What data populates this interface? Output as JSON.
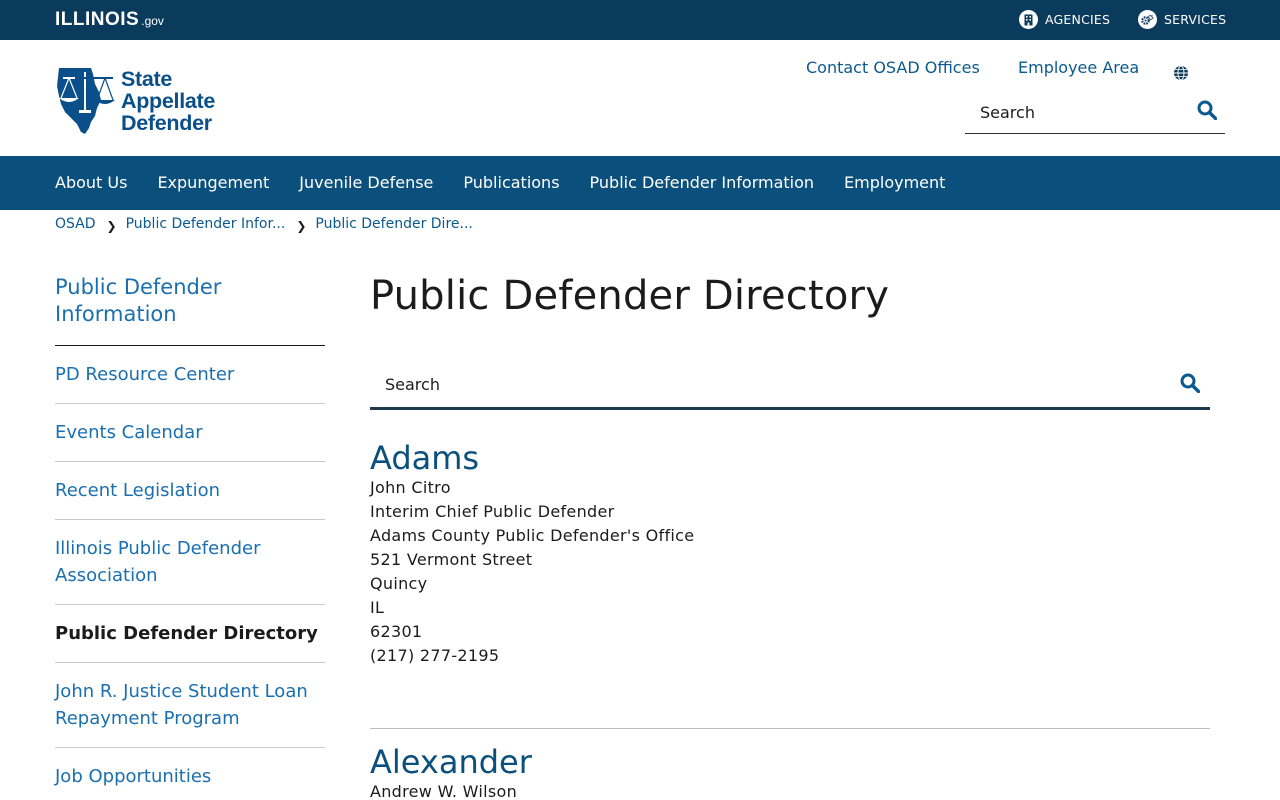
{
  "topbar": {
    "brand_main": "ILLINOIS",
    "brand_suffix": ".gov",
    "agencies_label": "AGENCIES",
    "services_label": "SERVICES"
  },
  "header": {
    "logo_lines": [
      "State",
      "Appellate",
      "Defender"
    ],
    "contact_link": "Contact OSAD Offices",
    "employee_link": "Employee Area",
    "search_placeholder": "Search"
  },
  "nav": {
    "items": [
      "About Us",
      "Expungement",
      "Juvenile Defense",
      "Publications",
      "Public Defender Information",
      "Employment"
    ]
  },
  "breadcrumb": [
    "OSAD",
    "Public Defender Infor...",
    "Public Defender Dire..."
  ],
  "sidebar": {
    "title": "Public Defender Information",
    "items": [
      {
        "label": "PD Resource Center",
        "active": false
      },
      {
        "label": "Events Calendar",
        "active": false
      },
      {
        "label": "Recent Legislation",
        "active": false
      },
      {
        "label": "Illinois Public Defender Association",
        "active": false
      },
      {
        "label": "Public Defender Directory",
        "active": true
      },
      {
        "label": "John R. Justice Student Loan Repayment Program",
        "active": false
      },
      {
        "label": "Job Opportunities",
        "active": false
      }
    ]
  },
  "main": {
    "title": "Public Defender Directory",
    "search_placeholder": "Search",
    "entries": [
      {
        "county": "Adams",
        "name": "John Citro",
        "role": "Interim Chief Public Defender",
        "office": "Adams County Public Defender's Office",
        "street": "521 Vermont Street",
        "city": "Quincy",
        "state": "IL",
        "zip": "62301",
        "phone": "(217) 277-2195"
      },
      {
        "county": "Alexander",
        "name": "Andrew W. Wilson"
      }
    ]
  },
  "colors": {
    "topbar": "#0b3b5c",
    "nav": "#0b507c",
    "link": "#1a6fb0",
    "heading": "#0b4f7c"
  }
}
